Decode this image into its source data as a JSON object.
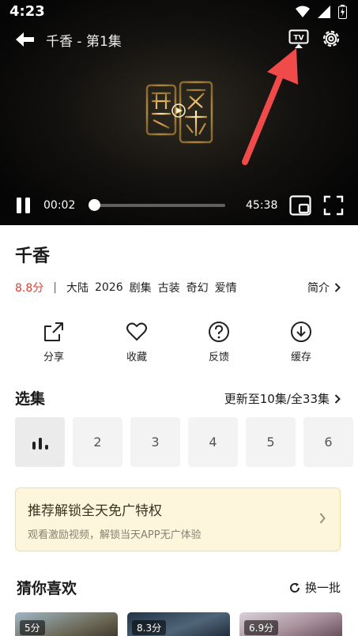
{
  "status": {
    "time": "4:23"
  },
  "player": {
    "title": "千香 - 第1集",
    "current_time": "00:02",
    "duration": "45:38",
    "progress_fraction": 0.001,
    "icons": [
      "back-arrow-icon",
      "tv-cast-icon",
      "gear-icon",
      "pause-icon",
      "pip-icon",
      "fullscreen-icon"
    ]
  },
  "show": {
    "title": "千香",
    "score": "8.8分",
    "separator": "|",
    "region": "大陆",
    "year": "2026",
    "kind": "剧集",
    "genres": [
      "古装",
      "奇幻",
      "爱情"
    ],
    "intro_label": "简介"
  },
  "actions": [
    {
      "label": "分享",
      "icon": "share-icon"
    },
    {
      "label": "收藏",
      "icon": "heart-icon"
    },
    {
      "label": "反馈",
      "icon": "help-icon"
    },
    {
      "label": "缓存",
      "icon": "download-icon"
    }
  ],
  "episodes_section": {
    "title": "选集",
    "update_text": "更新至10集/全33集",
    "episodes": [
      "2",
      "3",
      "4",
      "5",
      "6"
    ]
  },
  "promo": {
    "title": "推荐解锁全天免广特权",
    "subtitle": "观看激励视频，解锁当天APP无广体验"
  },
  "recommend": {
    "title": "猜你喜欢",
    "refresh_label": "换一批",
    "items": [
      {
        "score": "5分"
      },
      {
        "score": "8.3分"
      },
      {
        "score": "6.9分"
      }
    ]
  },
  "colors": {
    "score_red": "#e23b2e",
    "annotation_arrow": "#f04a4a",
    "promo_bg": "#fdf5dc"
  }
}
